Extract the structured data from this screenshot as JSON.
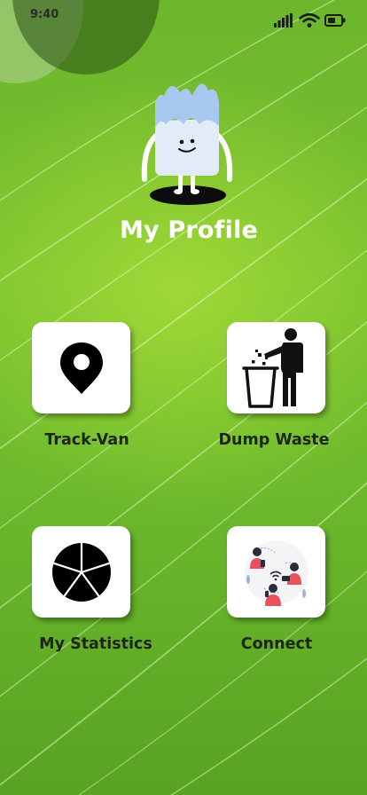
{
  "status_bar": {
    "time": "9:40",
    "icons": [
      "cellular-signal-icon",
      "wifi-icon",
      "battery-icon"
    ]
  },
  "header": {
    "title": "My Profile",
    "mascot": "milk-carton-mascot-illustration"
  },
  "menu": {
    "track_van": {
      "label": "Track-Van",
      "icon": "map-pin-icon"
    },
    "dump_waste": {
      "label": "Dump Waste",
      "icon": "trash-disposal-icon"
    },
    "my_statistics": {
      "label": "My Statistics",
      "icon": "pie-chart-icon"
    },
    "connect": {
      "label": "Connect",
      "icon": "people-connect-illustration"
    }
  },
  "colors": {
    "background_green": "#79c22f",
    "title_text": "#ffffff",
    "label_text": "#1e2418",
    "tile_background": "#ffffff",
    "mascot_cap": "#a8c8f0",
    "people_accent": "#e8505b"
  }
}
